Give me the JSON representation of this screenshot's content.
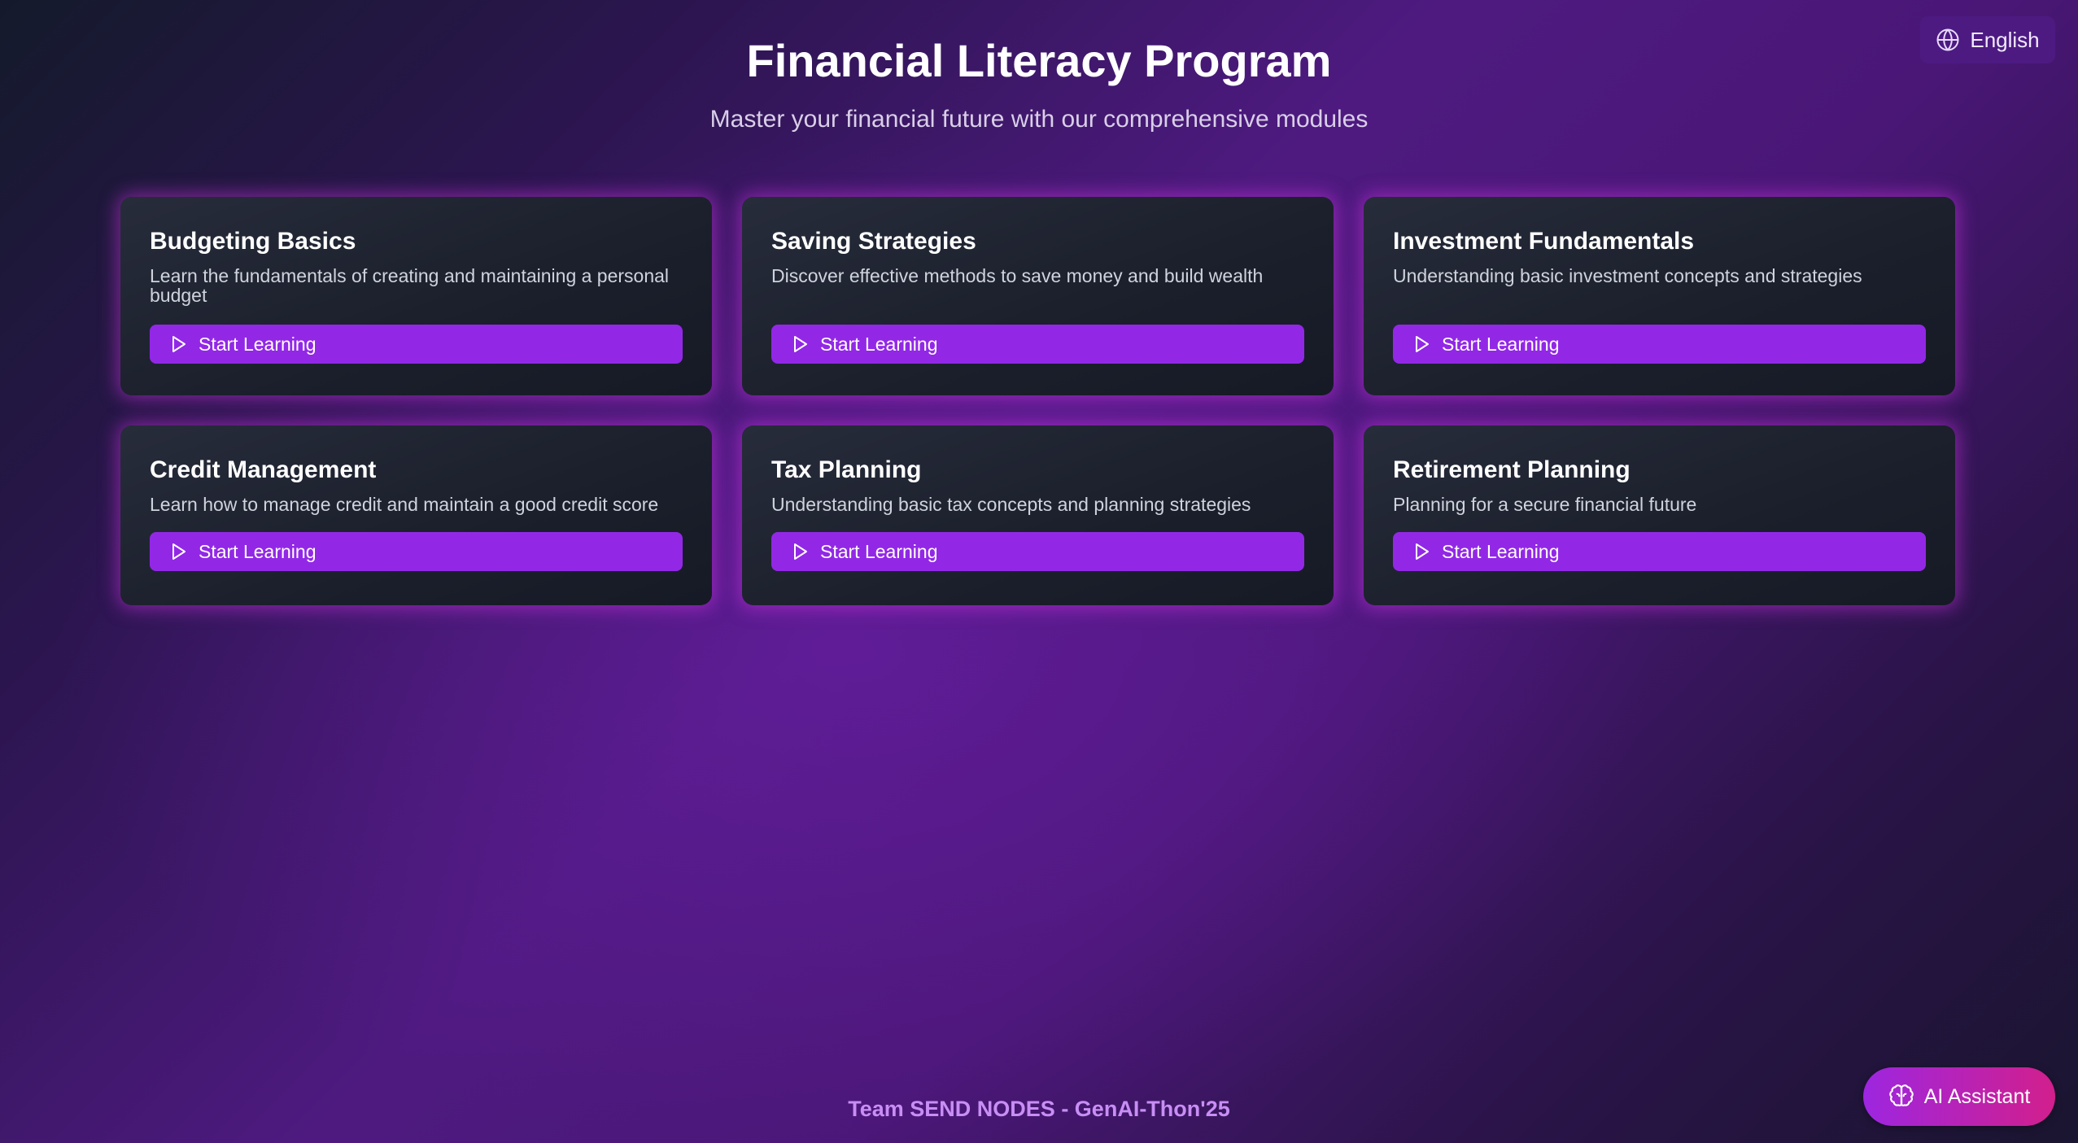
{
  "header": {
    "language_label": "English",
    "title": "Financial Literacy Program",
    "subtitle": "Master your financial future with our comprehensive modules"
  },
  "modules": [
    {
      "title": "Budgeting Basics",
      "description": "Learn the fundamentals of creating and maintaining a personal budget",
      "button_label": "Start Learning"
    },
    {
      "title": "Saving Strategies",
      "description": "Discover effective methods to save money and build wealth",
      "button_label": "Start Learning"
    },
    {
      "title": "Investment Fundamentals",
      "description": "Understanding basic investment concepts and strategies",
      "button_label": "Start Learning"
    },
    {
      "title": "Credit Management",
      "description": "Learn how to manage credit and maintain a good credit score",
      "button_label": "Start Learning"
    },
    {
      "title": "Tax Planning",
      "description": "Understanding basic tax concepts and planning strategies",
      "button_label": "Start Learning"
    },
    {
      "title": "Retirement Planning",
      "description": "Planning for a secure financial future",
      "button_label": "Start Learning"
    }
  ],
  "footer": {
    "team_text": "Team SEND NODES - GenAI-Thon'25"
  },
  "assistant": {
    "label": "AI Assistant"
  },
  "icons": {
    "language": "globe-icon",
    "start": "play-icon",
    "assistant": "brain-icon"
  },
  "colors": {
    "accent": "#9228e6",
    "language_button": "#4d1a82",
    "footer_text": "#c88ef5",
    "assistant_gradient_start": "#9d26e0",
    "assistant_gradient_end": "#d21f8c"
  }
}
